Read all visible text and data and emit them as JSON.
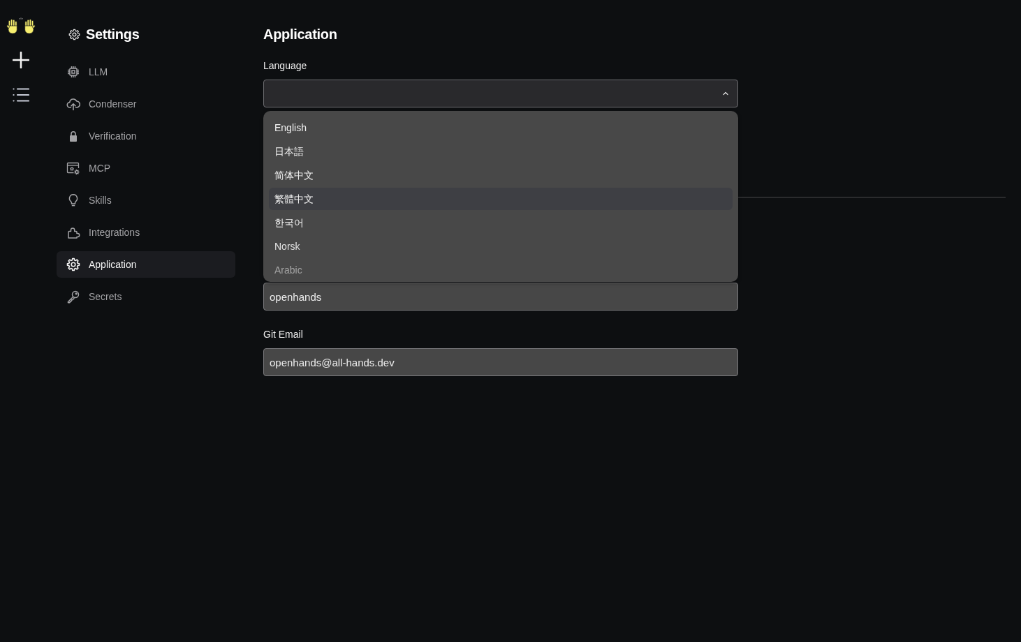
{
  "settings_nav": {
    "title": "Settings",
    "items": [
      {
        "label": "LLM",
        "selected": false
      },
      {
        "label": "Condenser",
        "selected": false
      },
      {
        "label": "Verification",
        "selected": false
      },
      {
        "label": "MCP",
        "selected": false
      },
      {
        "label": "Skills",
        "selected": false
      },
      {
        "label": "Integrations",
        "selected": false
      },
      {
        "label": "Application",
        "selected": true
      },
      {
        "label": "Secrets",
        "selected": false
      }
    ]
  },
  "page": {
    "title": "Application",
    "language": {
      "label": "Language",
      "expanded": true,
      "options": [
        {
          "label": "English",
          "highlighted": false
        },
        {
          "label": "日本語",
          "highlighted": false
        },
        {
          "label": "简体中文",
          "highlighted": false
        },
        {
          "label": "繁體中文",
          "highlighted": true
        },
        {
          "label": "한국어",
          "highlighted": false
        },
        {
          "label": "Norsk",
          "highlighted": false
        },
        {
          "label": "Arabic",
          "highlighted": false
        }
      ]
    },
    "git_username": {
      "value": "openhands"
    },
    "git_email": {
      "label": "Git Email",
      "value": "openhands@all-hands.dev"
    }
  }
}
